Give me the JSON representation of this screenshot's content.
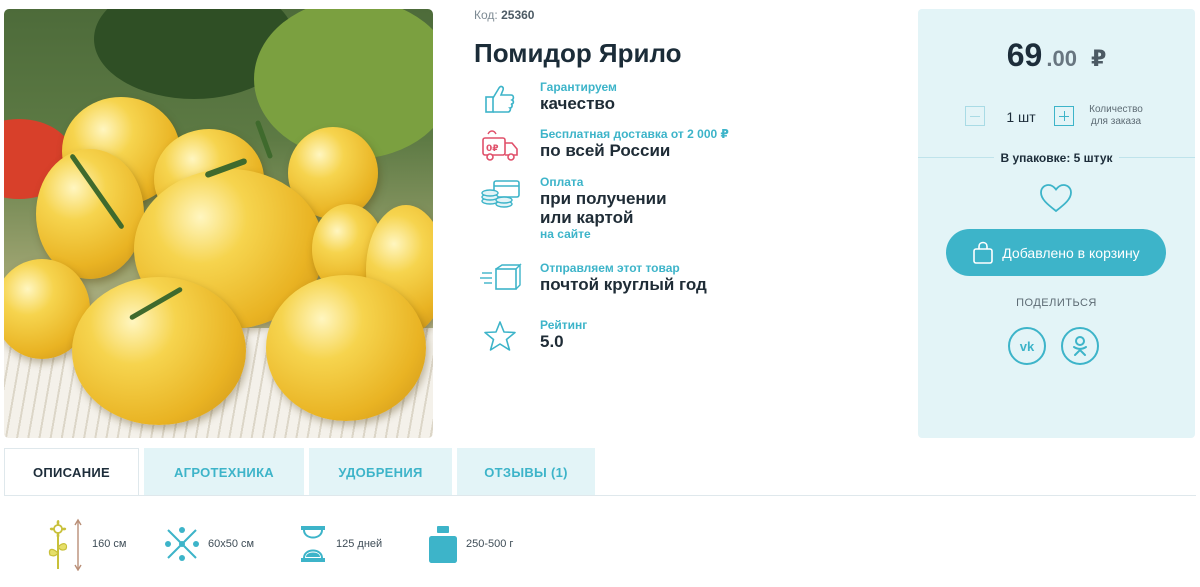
{
  "product": {
    "code_label": "Код:",
    "code_value": "25360",
    "title": "Помидор Ярило"
  },
  "features": [
    {
      "icon": "thumbs-up-icon",
      "small": "Гарантируем",
      "big": "качество",
      "small2": ""
    },
    {
      "icon": "delivery-truck-icon",
      "small": "Бесплатная доставка от 2 000 ₽",
      "big": "по всей России",
      "small2": ""
    },
    {
      "icon": "coins-card-icon",
      "small": "Оплата",
      "big": "при получении\nили картой",
      "small2": "на сайте"
    },
    {
      "icon": "parcel-box-icon",
      "small": "Отправляем этот товар",
      "big": "почтой круглый год",
      "small2": ""
    },
    {
      "icon": "star-icon",
      "small": "Рейтинг",
      "big": "5.0",
      "small2": ""
    }
  ],
  "panel": {
    "price_int": "69",
    "price_dec": ".00",
    "currency": "₽",
    "qty_value": "1 шт",
    "qty_label": "Количество для заказа",
    "pack_label": "В упаковке: 5 штук",
    "cart_label": "Добавлено в корзину",
    "share_label": "ПОДЕЛИТЬСЯ",
    "vk_label": "vk",
    "ok_label": "ok"
  },
  "tabs": [
    {
      "label": "ОПИСАНИЕ",
      "active": true
    },
    {
      "label": "АГРОТЕХНИКА",
      "active": false
    },
    {
      "label": "УДОБРЕНИЯ",
      "active": false
    },
    {
      "label": "ОТЗЫВЫ (1)",
      "active": false
    }
  ],
  "characteristics": [
    {
      "icon": "plant-height-icon",
      "value": "160 см"
    },
    {
      "icon": "planting-scheme-icon",
      "value": "60x50 см"
    },
    {
      "icon": "hourglass-icon",
      "value": "125 дней"
    },
    {
      "icon": "weight-icon",
      "value": "250-500 г"
    }
  ],
  "colors": {
    "accent": "#3db4c9",
    "panel_bg": "#e3f4f7",
    "text_dark": "#1d2d3a"
  }
}
